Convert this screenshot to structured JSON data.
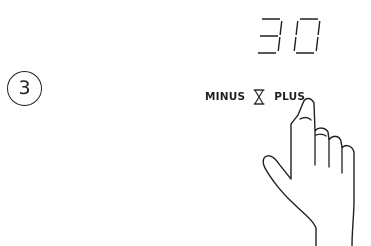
{
  "step": {
    "number": "3"
  },
  "display": {
    "digits": [
      "3",
      "0"
    ]
  },
  "controls": {
    "minus_label": "MINUS",
    "plus_label": "PLUS"
  },
  "icons": {
    "timer": "hourglass-icon",
    "pointer": "hand-pointer-icon"
  },
  "colors": {
    "ink": "#231f20",
    "background": "#ffffff"
  }
}
